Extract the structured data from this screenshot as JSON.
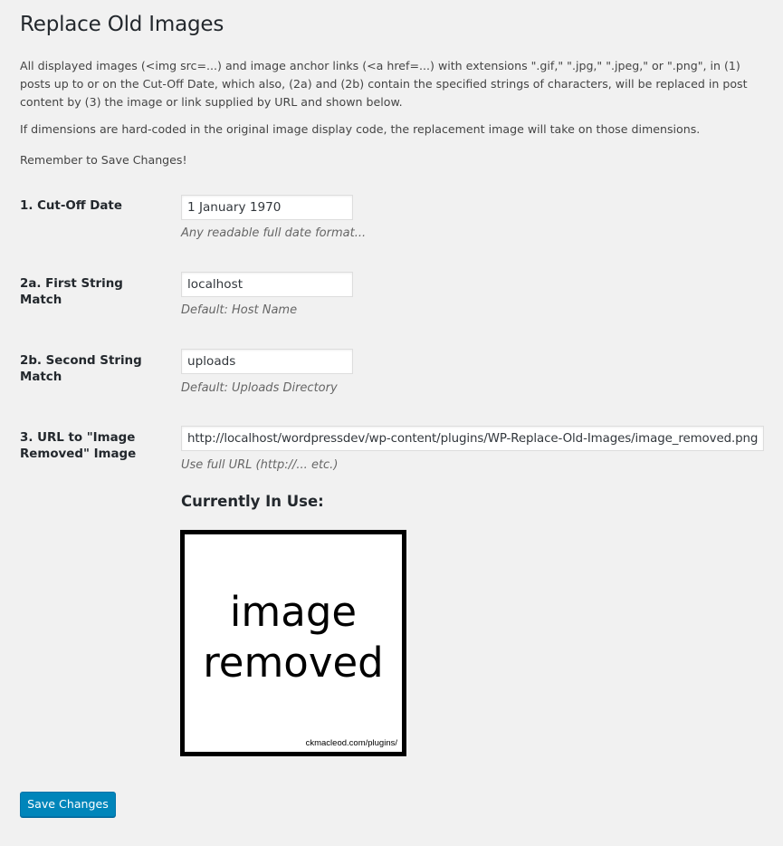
{
  "page": {
    "title": "Replace Old Images",
    "intro": "All displayed images (<img src=...) and image anchor links (<a href=...) with extensions \".gif,\" \".jpg,\" \".jpeg,\" or \".png\", in (1) posts up to or on the Cut-Off Date, which also, (2a) and (2b) contain the specified strings of characters, will be replaced in post content by (3) the image or link supplied by URL and shown below.",
    "dimensions_note": "If dimensions are hard-coded in the original image display code, the replacement image will take on those dimensions.",
    "reminder": "Remember to Save Changes!"
  },
  "fields": {
    "cutoff": {
      "label": "1. Cut-Off Date",
      "value": "1 January 1970",
      "hint": "Any readable full date format..."
    },
    "first_string": {
      "label": "2a. First String Match",
      "value": "localhost",
      "hint": "Default: Host Name"
    },
    "second_string": {
      "label": "2b. Second String Match",
      "value": "uploads",
      "hint": "Default: Uploads Directory"
    },
    "image_url": {
      "label": "3. URL to \"Image Removed\" Image",
      "value": "http://localhost/wordpressdev/wp-content/plugins/WP-Replace-Old-Images/image_removed.png",
      "hint": "Use full URL (http://... etc.)"
    }
  },
  "preview": {
    "heading": "Currently In Use:",
    "image_line1": "image",
    "image_line2": "removed",
    "image_credit": "ckmacleod.com/plugins/"
  },
  "actions": {
    "save_label": "Save Changes"
  },
  "colors": {
    "background": "#f1f1f1",
    "primary_button": "#0085ba"
  }
}
